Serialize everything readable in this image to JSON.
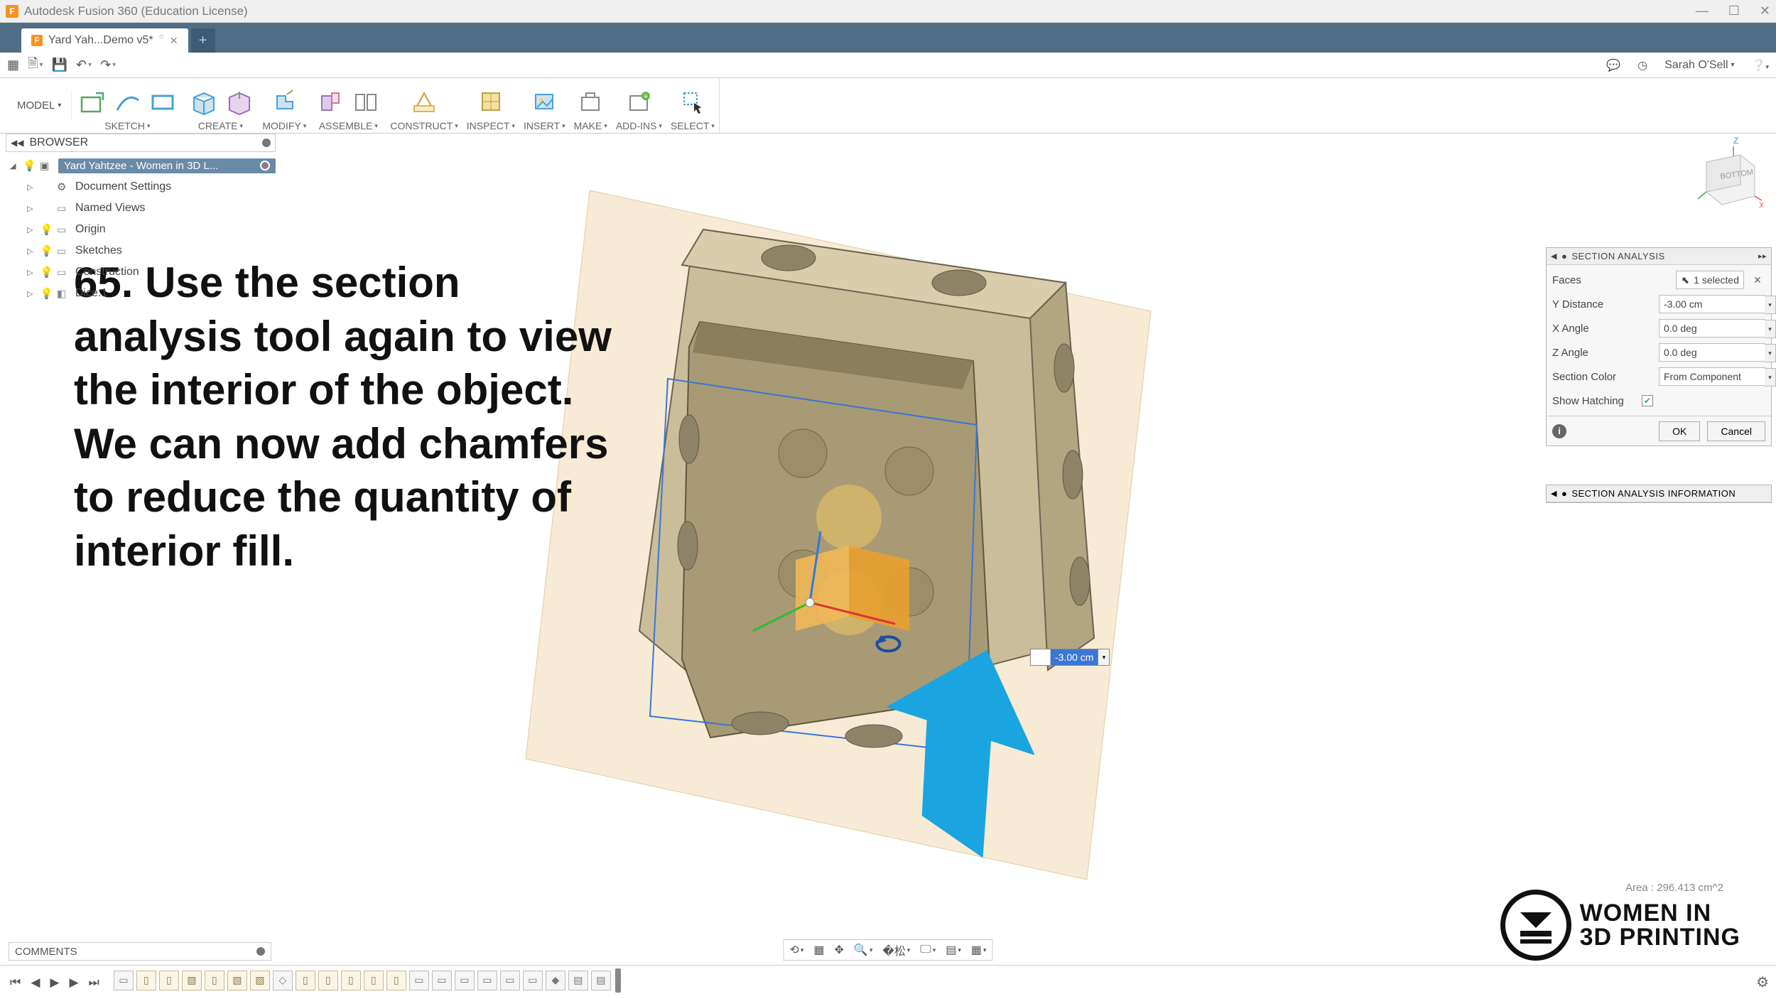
{
  "app": {
    "title": "Autodesk Fusion 360 (Education License)",
    "logo_letter": "F"
  },
  "tab": {
    "label": "Yard Yah...Demo v5*"
  },
  "quick": {
    "user": "Sarah O'Sell"
  },
  "ribbon": {
    "model": "MODEL",
    "groups": [
      "SKETCH",
      "CREATE",
      "MODIFY",
      "ASSEMBLE",
      "CONSTRUCT",
      "INSPECT",
      "INSERT",
      "MAKE",
      "ADD-INS",
      "SELECT"
    ]
  },
  "browser": {
    "title": "BROWSER",
    "root": "Yard Yahtzee - Women in 3D L...",
    "items": [
      {
        "type": "settings",
        "label": "Document Settings"
      },
      {
        "type": "folder",
        "label": "Named Views"
      },
      {
        "type": "origin",
        "label": "Origin"
      },
      {
        "type": "sketches",
        "label": "Sketches"
      },
      {
        "type": "construction",
        "label": "Construction"
      },
      {
        "type": "body",
        "label": "Dice:1"
      }
    ]
  },
  "instruction": "65. Use the section analysis tool again to view the interior of the object. We can now add chamfers to reduce the quantity of interior fill.",
  "section_panel": {
    "title": "SECTION ANALYSIS",
    "faces_label": "Faces",
    "faces_value": "1 selected",
    "rows": [
      {
        "label": "Y Distance",
        "value": "-3.00 cm"
      },
      {
        "label": "X Angle",
        "value": "0.0 deg"
      },
      {
        "label": "Z Angle",
        "value": "0.0 deg"
      },
      {
        "label": "Section Color",
        "value": "From Component"
      }
    ],
    "hatching_label": "Show Hatching",
    "ok": "OK",
    "cancel": "Cancel",
    "info_title": "SECTION ANALYSIS INFORMATION"
  },
  "dim_value": "-3.00 cm",
  "comments": "COMMENTS",
  "status_text": "Area : 296.413 cm^2",
  "watermark": {
    "line1": "WOMEN IN",
    "line2": "3D PRINTING"
  }
}
